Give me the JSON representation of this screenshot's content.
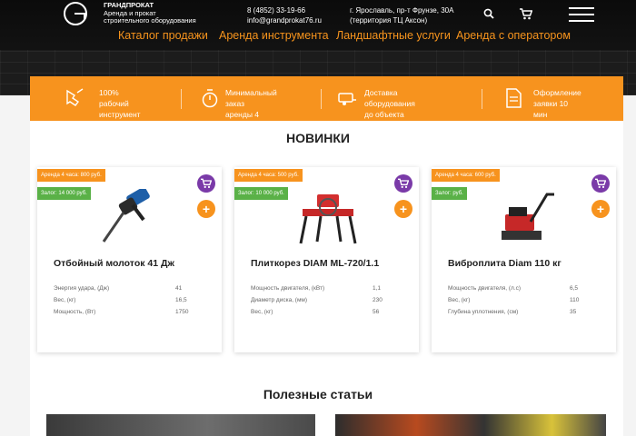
{
  "header": {
    "brand_name": "ГРАНДПРОКАТ",
    "brand_line1": "Аренда и прокат",
    "brand_line2": "строительного оборудования",
    "phone": "8 (4852) 33-19-66",
    "email": "info@grandprokat76.ru",
    "address_line1": "г. Ярославль, пр-т Фрунзе, 30А",
    "address_line2": "(территория ТЦ Аксон)"
  },
  "nav": {
    "items": [
      {
        "label": "Каталог продажи"
      },
      {
        "label": "Аренда инструмента"
      },
      {
        "label": "Ландшафтные услуги"
      },
      {
        "label": "Аренда с оператором"
      }
    ]
  },
  "features": [
    {
      "line1": "100% рабочий",
      "line2": "инструмент",
      "icon": "drill-icon"
    },
    {
      "line1": "Минимальный заказ",
      "line2": "аренды 4 часа",
      "icon": "stopwatch-icon"
    },
    {
      "line1": "Доставка оборудования",
      "line2": "до объекта",
      "icon": "trailer-icon"
    },
    {
      "line1": "Оформление",
      "line2": "заявки 10 мин",
      "icon": "document-icon"
    }
  ],
  "sections": {
    "new_title": "НОВИНКИ",
    "articles_title": "Полезные статьи"
  },
  "products": [
    {
      "rent": "Аренда 4 часа: 800 руб.",
      "deposit": "Залог: 14 000 руб.",
      "title": "Отбойный молоток 41 Дж",
      "specs": [
        {
          "k": "Энергия удара, (Дж)",
          "v": "41"
        },
        {
          "k": "Вес, (кг)",
          "v": "16,5"
        },
        {
          "k": "Мощность, (Вт)",
          "v": "1750"
        }
      ]
    },
    {
      "rent": "Аренда 4 часа: 500 руб.",
      "deposit": "Залог: 10 000 руб.",
      "title": "Плиткорез DIAM ML-720/1.1",
      "specs": [
        {
          "k": "Мощность двигателя, (кВт)",
          "v": "1,1"
        },
        {
          "k": "Диаметр диска, (мм)",
          "v": "230"
        },
        {
          "k": "Вес, (кг)",
          "v": "56"
        }
      ]
    },
    {
      "rent": "Аренда 4 часа: 600 руб.",
      "deposit": "Залог: руб.",
      "title": "Виброплита Diam 110 кг",
      "specs": [
        {
          "k": "Мощность двигателя, (л.с)",
          "v": "6,5"
        },
        {
          "k": "Вес, (кг)",
          "v": "110"
        },
        {
          "k": "Глубина уплотнения, (см)",
          "v": "35"
        }
      ]
    }
  ],
  "icons": {
    "search": "search-icon",
    "cart": "cart-icon",
    "menu": "menu-icon",
    "add": "+"
  },
  "colors": {
    "accent": "#f7931e",
    "deposit": "#5ab147",
    "cart_button": "#7a3aa8"
  }
}
